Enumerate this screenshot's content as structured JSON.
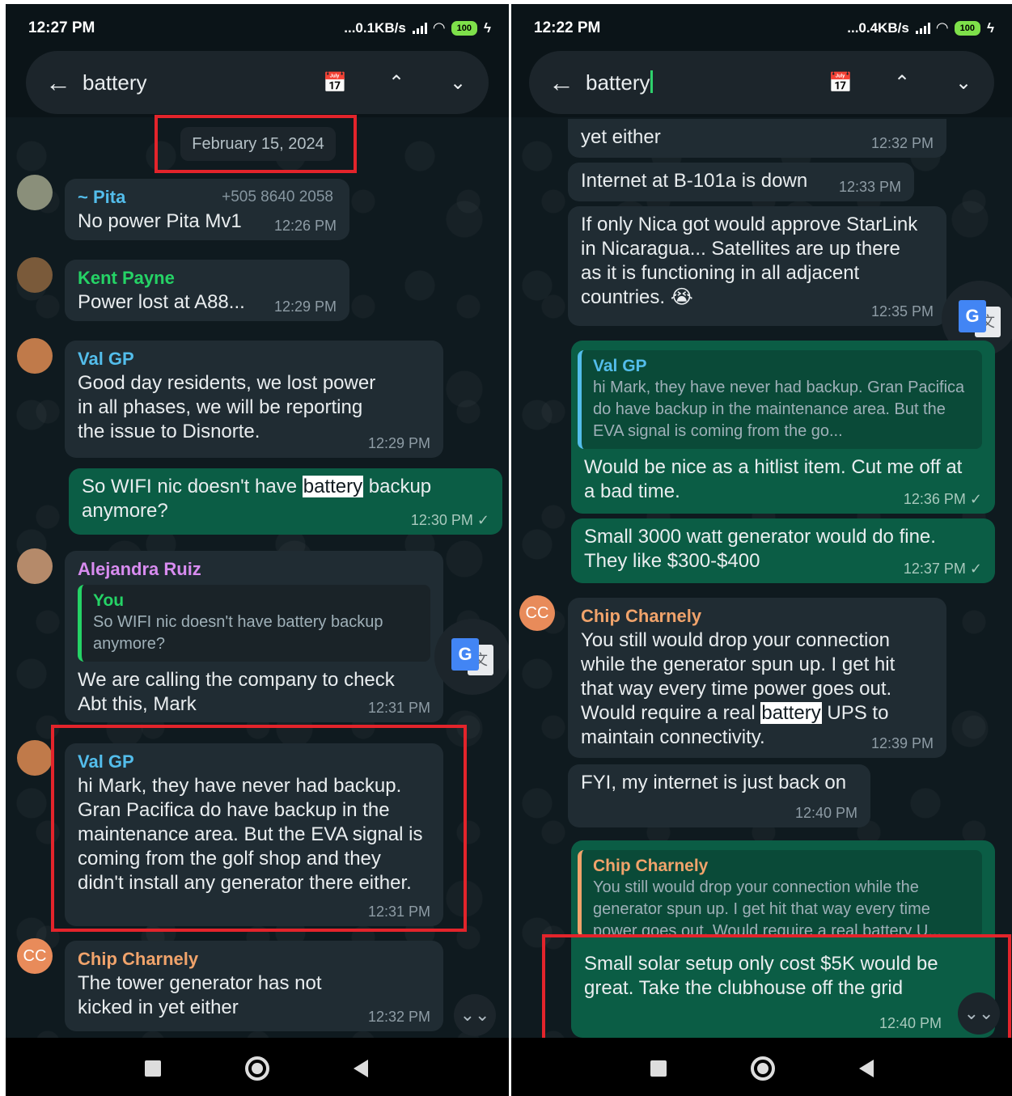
{
  "left": {
    "status": {
      "time": "12:27 PM",
      "net": "...0.1KB/s",
      "battery": "100"
    },
    "search": {
      "query": "battery"
    },
    "date_chip": "February 15, 2024",
    "messages": [
      {
        "sender": "~ Pita",
        "sender_color": "#53bdeb",
        "phone": "+505 8640 2058",
        "text": "No power Pita  Mv1",
        "time": "12:26 PM"
      },
      {
        "sender": "Kent Payne",
        "sender_color": "#25d366",
        "text": "Power lost at A88...",
        "time": "12:29 PM"
      },
      {
        "sender": "Val GP",
        "sender_color": "#53bdeb",
        "text": "Good day residents, we lost power in all phases, we will be reporting the issue to Disnorte.",
        "time": "12:29 PM"
      },
      {
        "text_before": "So WIFI nic doesn't have ",
        "highlight": "battery",
        "text_after": " backup anymore?",
        "time": "12:30 PM ✓"
      },
      {
        "sender": "Alejandra Ruiz",
        "sender_color": "#d88cf0",
        "quote_name": "You",
        "quote_text": "So WIFI nic doesn't have battery backup anymore?",
        "text": "We are calling the company to check Abt this, Mark",
        "time": "12:31 PM"
      },
      {
        "sender": "Val GP",
        "sender_color": "#53bdeb",
        "text": "hi Mark, they have never had backup. Gran Pacifica do have backup in the maintenance area. But the EVA signal is coming from the golf shop and they didn't install any generator there either.",
        "time": "12:31 PM"
      },
      {
        "sender": "Chip Charnely",
        "sender_color": "#f0a36b",
        "avatar": "CC",
        "text": "The tower generator has not kicked in yet either",
        "time": "12:32 PM"
      }
    ]
  },
  "right": {
    "status": {
      "time": "12:22 PM",
      "net": "...0.4KB/s",
      "battery": "100"
    },
    "search": {
      "query": "battery"
    },
    "messages": [
      {
        "text": "yet either",
        "time": "12:32 PM"
      },
      {
        "text": "Internet at B-101a is down",
        "time": "12:33 PM"
      },
      {
        "text": "If only Nica got would approve StarLink in Nicaragua... Satellites are up there as it is functioning in all adjacent countries. 😭",
        "time": "12:35 PM"
      },
      {
        "quote_name": "Val GP",
        "quote_text": "hi Mark, they have never had backup. Gran Pacifica do have backup in the maintenance area. But the EVA signal is coming from the go...",
        "text": "Would be nice as a hitlist item. Cut me off at a bad time.",
        "time": "12:36 PM ✓"
      },
      {
        "text": "Small 3000 watt generator would do fine. They like $300-$400",
        "time": "12:37 PM ✓"
      },
      {
        "sender": "Chip Charnely",
        "sender_color": "#f0a36b",
        "avatar": "CC",
        "text_before": "You still would drop your connection while the generator spun up. I get hit that way every time power goes out. Would require a real ",
        "highlight": "battery",
        "text_after": " UPS to maintain connectivity.",
        "time": "12:39 PM"
      },
      {
        "text": "FYI, my internet is just back on",
        "time": "12:40 PM"
      },
      {
        "quote_name": "Chip Charnely",
        "quote_text": "You still would drop your connection while the generator spun up. I get hit that way every time power goes out. Would require a real battery U...",
        "text": "Small solar setup only cost $5K would be great. Take the clubhouse off the grid",
        "time": "12:40 PM"
      }
    ]
  },
  "icons": {
    "back": "arrow-left-icon",
    "calendar": "calendar-search-icon",
    "up": "chevron-up-icon",
    "down": "chevron-down-icon",
    "translate": "google-translate-icon",
    "scroll": "double-chevron-down-icon"
  },
  "colors": {
    "highlight_box": "#e3242b",
    "outgoing": "#0b5d45",
    "incoming": "#202c33"
  }
}
